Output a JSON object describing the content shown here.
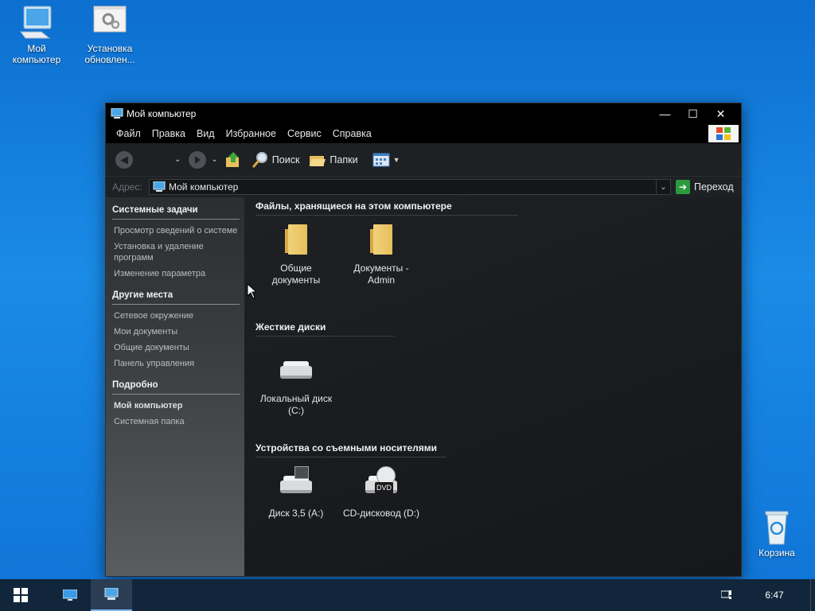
{
  "desktop": {
    "icons": [
      {
        "label_line1": "Мой",
        "label_line2": "компьютер"
      },
      {
        "label_line1": "Установка",
        "label_line2": "обновлен..."
      },
      {
        "label_line1": "Корзина",
        "label_line2": ""
      }
    ]
  },
  "window": {
    "title": "Мой компьютер",
    "controls": {
      "minimize": "—",
      "maximize": "☐",
      "close": "✕"
    },
    "menu": [
      "Файл",
      "Правка",
      "Вид",
      "Избранное",
      "Сервис",
      "Справка"
    ],
    "toolbar": {
      "back_arrow": "◀",
      "dropdown": "⌄",
      "search_label": "Поиск",
      "folders_label": "Папки"
    },
    "address": {
      "label": "Адрес:",
      "value": "Мой компьютер",
      "go_label": "Переход"
    },
    "sidebar": {
      "system_tasks": {
        "title": "Системные задачи",
        "items": [
          "Просмотр сведений о системе",
          "Установка и удаление программ",
          "Изменение параметра"
        ]
      },
      "other_places": {
        "title": "Другие места",
        "items": [
          "Сетевое окружение",
          "Мои документы",
          "Общие документы",
          "Панель управления"
        ]
      },
      "details": {
        "title": "Подробно",
        "items": [
          "Мой компьютер",
          "Системная папка"
        ]
      }
    },
    "sections": {
      "files": {
        "title": "Файлы, хранящиеся на этом компьютере",
        "items": [
          {
            "line1": "Общие",
            "line2": "документы"
          },
          {
            "line1": "Документы -",
            "line2": "Admin"
          }
        ]
      },
      "hard_drives": {
        "title": "Жесткие диски",
        "items": [
          {
            "line1": "Локальный диск",
            "line2": "(C:)"
          }
        ]
      },
      "removable": {
        "title": "Устройства со съемными носителями",
        "items": [
          {
            "line1": "Диск 3,5 (A:)",
            "line2": ""
          },
          {
            "line1": "CD-дисковод (D:)",
            "line2": ""
          }
        ],
        "dvd_badge": "DVD"
      }
    }
  },
  "taskbar": {
    "clock": "6:47"
  },
  "colors": {
    "desktop_blue": "#1a8be6",
    "window_bg": "#1b1d20",
    "taskbar_bg": "#11263b"
  }
}
